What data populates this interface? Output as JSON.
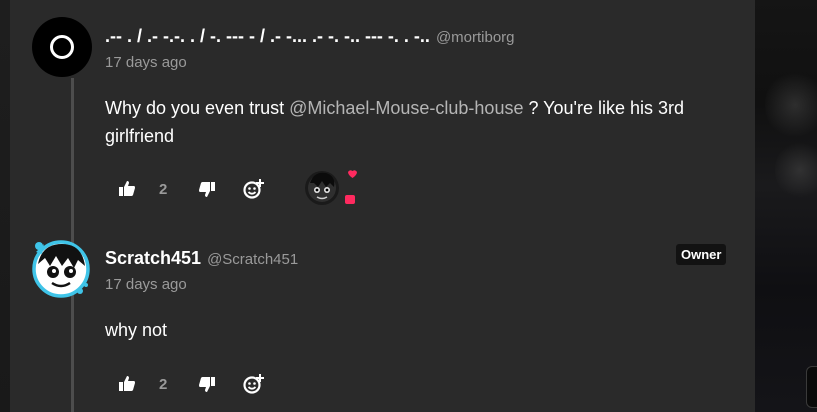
{
  "comments": [
    {
      "author": ".-- . / .- -.-. . / -. --- - / .- -... .- -. -.. --- -. . -..",
      "handle": "@mortiborg",
      "time": "17 days ago",
      "text_before": "Why do you even trust ",
      "mention": "@Michael-Mouse-club-house",
      "text_after": " ? You're like his 3rd girlfriend",
      "likes": "2",
      "avatar_icon": "black-circle-ring-avatar"
    },
    {
      "author": "Scratch451",
      "handle": "@Scratch451",
      "badge": "Owner",
      "time": "17 days ago",
      "text": "why not",
      "likes": "2",
      "avatar_icon": "cartoon-character-avatar"
    }
  ],
  "colors": {
    "panel": "#2a2a2a",
    "muted": "#9a9a9a",
    "reaction_pink": "#ff2a5f",
    "avatar_ring": "#3fc4e8"
  }
}
